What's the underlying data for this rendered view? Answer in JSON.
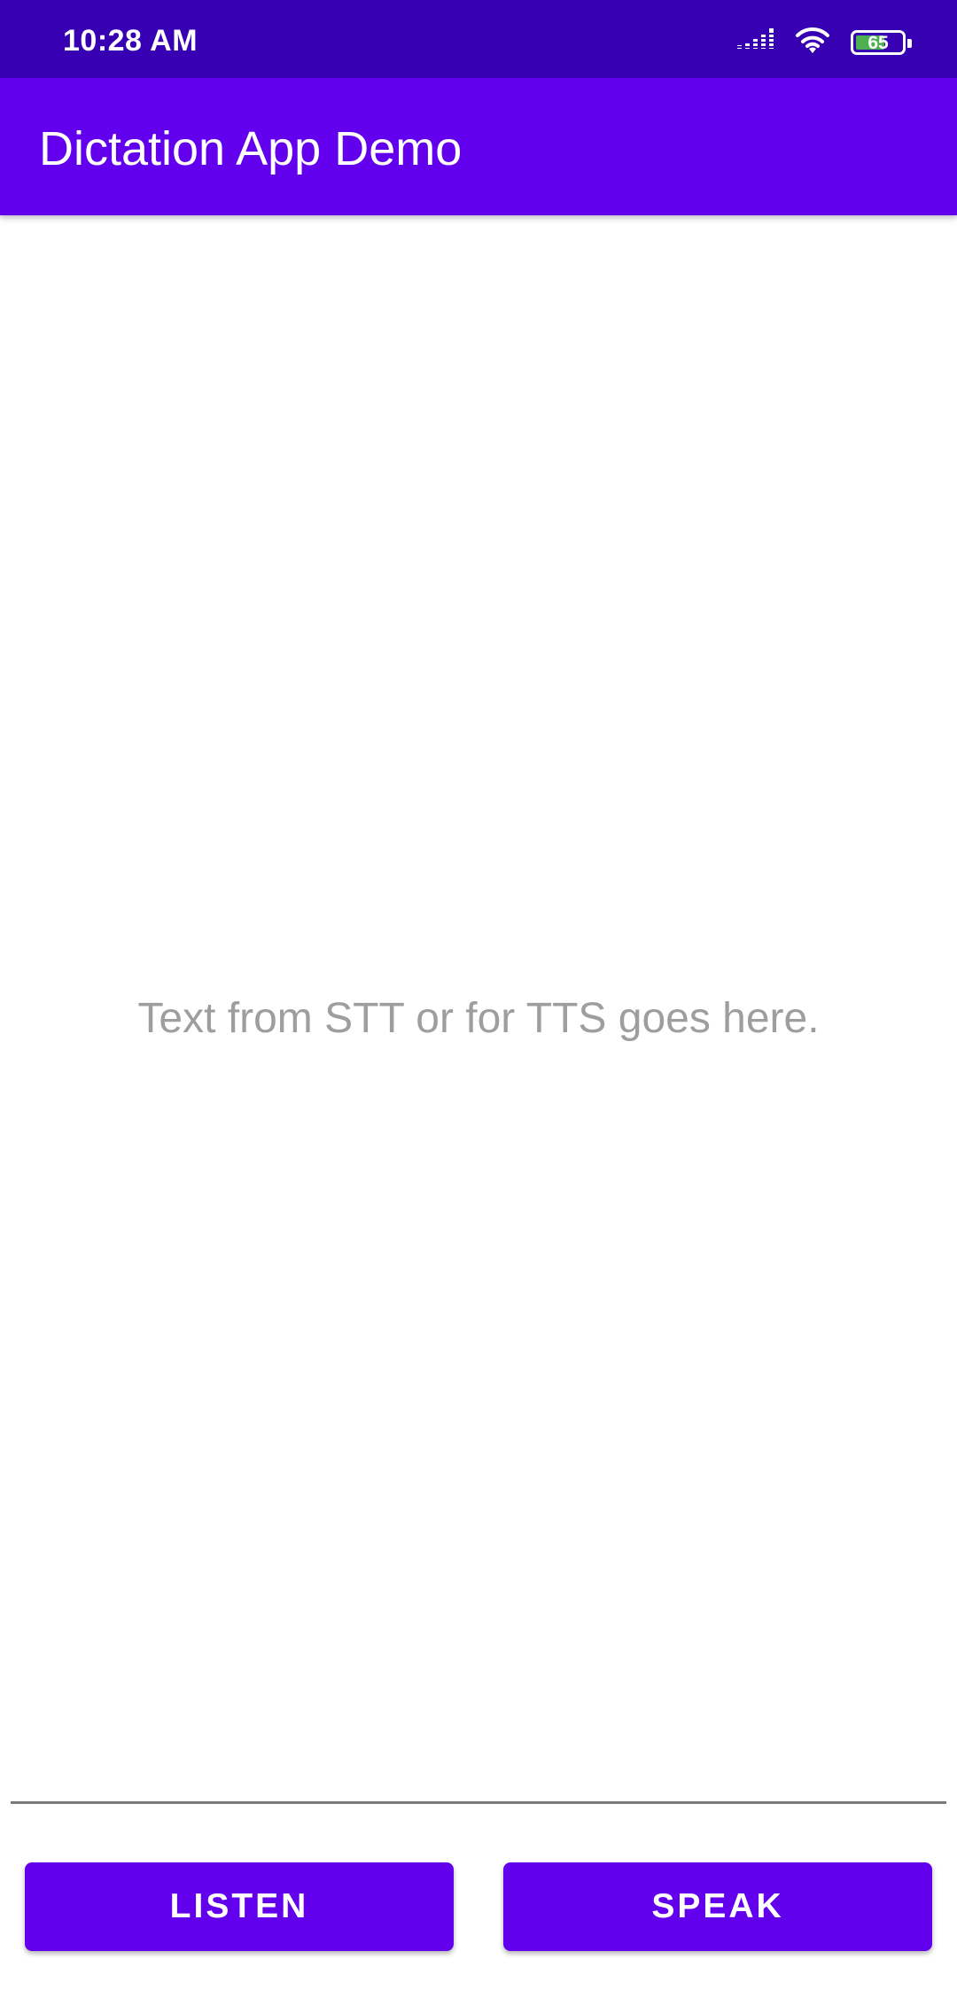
{
  "status_bar": {
    "time": "10:28 AM",
    "battery_level": "65",
    "battery_fraction": 0.65,
    "icons": [
      "signal-icon",
      "wifi-icon",
      "battery-icon"
    ]
  },
  "app_bar": {
    "title": "Dictation App Demo"
  },
  "main": {
    "placeholder_text": "Text from STT or for TTS goes here."
  },
  "buttons": {
    "listen_label": "LISTEN",
    "speak_label": "SPEAK"
  },
  "colors": {
    "status_bar": "#3700b3",
    "primary": "#6200ee",
    "placeholder_text": "#9e9e9e",
    "battery_fill": "#4caf50"
  }
}
